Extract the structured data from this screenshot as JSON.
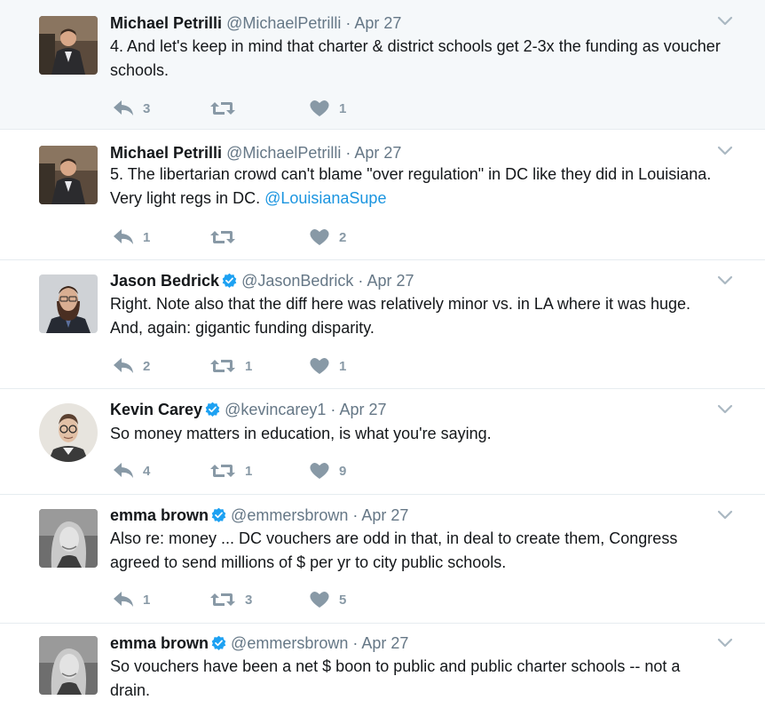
{
  "tweets": [
    {
      "name": "Michael Petrilli",
      "verified": false,
      "handle": "@MichaelPetrilli",
      "dot": "·",
      "date": "Apr 27",
      "text": "4. And let's keep in mind that charter & district schools get 2-3x the funding as voucher schools.",
      "mention": "",
      "replies": "3",
      "retweets": "",
      "likes": "1"
    },
    {
      "name": "Michael Petrilli",
      "verified": false,
      "handle": "@MichaelPetrilli",
      "dot": "·",
      "date": "Apr 27",
      "text": "5. The libertarian crowd can't blame \"over regulation\" in DC like they did in Louisiana. Very light regs in DC. ",
      "mention": "@LouisianaSupe",
      "replies": "1",
      "retweets": "",
      "likes": "2"
    },
    {
      "name": "Jason Bedrick",
      "verified": true,
      "handle": "@JasonBedrick",
      "dot": "·",
      "date": "Apr 27",
      "text": "Right. Note also that the diff here was relatively minor vs. in LA where it was huge. And, again: gigantic funding disparity.",
      "mention": "",
      "replies": "2",
      "retweets": "1",
      "likes": "1"
    },
    {
      "name": "Kevin Carey",
      "verified": true,
      "handle": "@kevincarey1",
      "dot": "·",
      "date": "Apr 27",
      "text": "So money matters in education, is what you're saying.",
      "mention": "",
      "replies": "4",
      "retweets": "1",
      "likes": "9"
    },
    {
      "name": "emma brown",
      "verified": true,
      "handle": "@emmersbrown",
      "dot": "·",
      "date": "Apr 27",
      "text": "Also re: money ... DC vouchers are odd in that, in deal to create them, Congress agreed to send millions of $ per yr to city public schools.",
      "mention": "",
      "replies": "1",
      "retweets": "3",
      "likes": "5"
    },
    {
      "name": "emma brown",
      "verified": true,
      "handle": "@emmersbrown",
      "dot": "·",
      "date": "Apr 27",
      "text": "So vouchers have been a net $ boon to public and public charter schools -- not a drain.",
      "mention": "",
      "replies": "",
      "retweets": "",
      "likes": ""
    }
  ],
  "colors": {
    "thread_line": "#6fb1de",
    "link": "#1b95e0",
    "icon": "#8899a6",
    "highlight_bg": "#f5f8fa"
  },
  "icons": [
    "reply-icon",
    "retweet-icon",
    "heart-icon",
    "verified-badge-icon",
    "caret-down-icon"
  ]
}
